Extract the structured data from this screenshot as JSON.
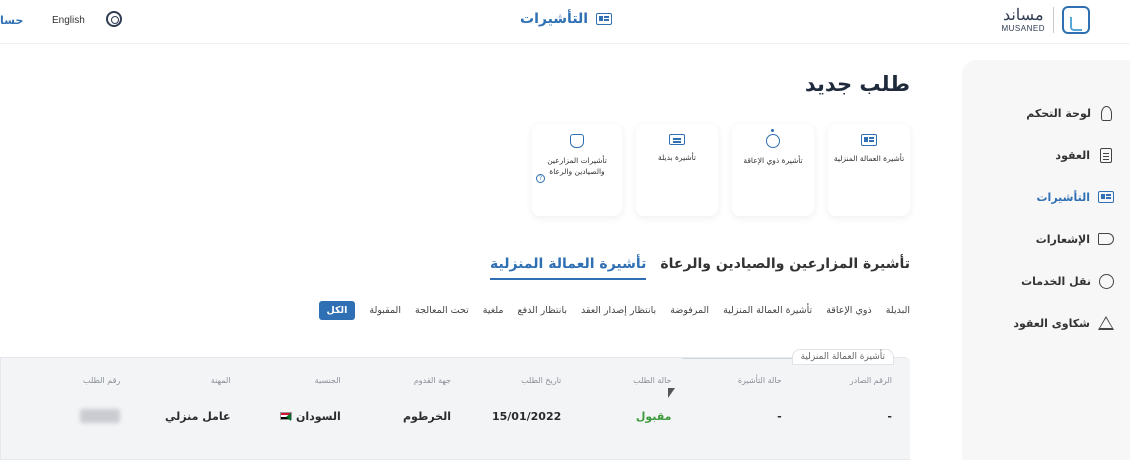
{
  "header": {
    "brand_ar": "مساند",
    "brand_en": "MUSANED",
    "page_title": "التأشيرات",
    "language": "English",
    "account_label": "حسا"
  },
  "sidebar": {
    "items": [
      {
        "label": "لوحة التحكم",
        "icon": "rocket-icon",
        "active": false
      },
      {
        "label": "العقود",
        "icon": "document-icon",
        "active": false
      },
      {
        "label": "التأشيرات",
        "icon": "id-card-icon",
        "active": true
      },
      {
        "label": "الإشعارات",
        "icon": "megaphone-icon",
        "active": false
      },
      {
        "label": "نقل الخدمات",
        "icon": "transfer-icon",
        "active": false
      },
      {
        "label": "شكاوى العقود",
        "icon": "warning-icon",
        "active": false
      }
    ]
  },
  "main": {
    "title": "طلب جديد",
    "cards": [
      {
        "label": "تأشيرة العمالة المنزلية",
        "icon": "id-card-icon"
      },
      {
        "label": "تأشيرة ذوي الإعاقة",
        "icon": "wheelchair-icon"
      },
      {
        "label": "تأشيرة بديلة",
        "icon": "swap-card-icon"
      },
      {
        "label": "تأشيرات المزارعين والصيادين والرعاة",
        "icon": "farmer-icon",
        "badge": "?"
      }
    ],
    "tabs": [
      {
        "label": "تأشيرة العمالة المنزلية",
        "active": true
      },
      {
        "label": "تأشيرة المزارعين والصيادين والرعاة",
        "active": false
      }
    ],
    "filters": [
      {
        "label": "الكل",
        "active": true
      },
      {
        "label": "المقبولة",
        "active": false
      },
      {
        "label": "تحت المعالجة",
        "active": false
      },
      {
        "label": "ملغية",
        "active": false
      },
      {
        "label": "بانتظار الدفع",
        "active": false
      },
      {
        "label": "بانتظار إصدار العقد",
        "active": false
      },
      {
        "label": "المرفوضة",
        "active": false
      },
      {
        "label": "تأشيرة العمالة المنزلية",
        "active": false
      },
      {
        "label": "ذوي الإعاقة",
        "active": false
      },
      {
        "label": "البديلة",
        "active": false
      }
    ],
    "result_panel": {
      "legend": "تأشيرة العمالة المنزلية",
      "columns": [
        "رقم الطلب",
        "المهنة",
        "الجنسية",
        "جهة القدوم",
        "تاريخ الطلب",
        "حالة الطلب",
        "حالة التأشيرة",
        "الرقم الصادر"
      ],
      "row": {
        "request_number": "",
        "profession": "عامل منزلي",
        "nationality": "السودان",
        "arrival": "الخرطوم",
        "date": "15/01/2022",
        "status": "مقبول",
        "visa_status": "-",
        "issued_number": "-"
      },
      "status_color": "#3c9a3c"
    }
  },
  "colors": {
    "accent": "#2f6fb3",
    "sidebar_bg": "#f7f7f8",
    "panel_bg": "#f3f4f6"
  }
}
